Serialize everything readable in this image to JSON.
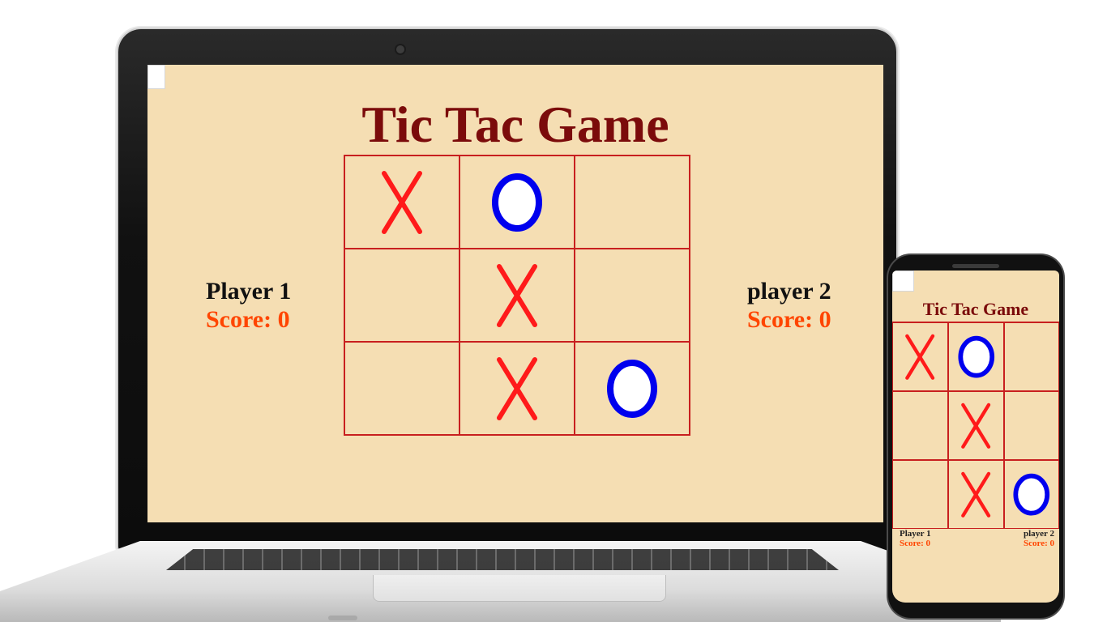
{
  "game": {
    "title": "Tic Tac Game",
    "board": [
      "X",
      "O",
      "",
      "",
      "X",
      "",
      "",
      "X",
      "O"
    ],
    "player1": {
      "name": "Player 1",
      "score": "Score: 0"
    },
    "player2": {
      "name": "player 2",
      "score": "Score: 0"
    }
  },
  "colors": {
    "background": "#f5deb3",
    "title": "#7b0b0b",
    "grid": "#c81f1f",
    "x_mark": "#ff1a1a",
    "o_mark": "#0000ee",
    "score": "#ff4500"
  },
  "icons": {
    "x": "x-mark-icon",
    "o": "o-mark-icon"
  }
}
